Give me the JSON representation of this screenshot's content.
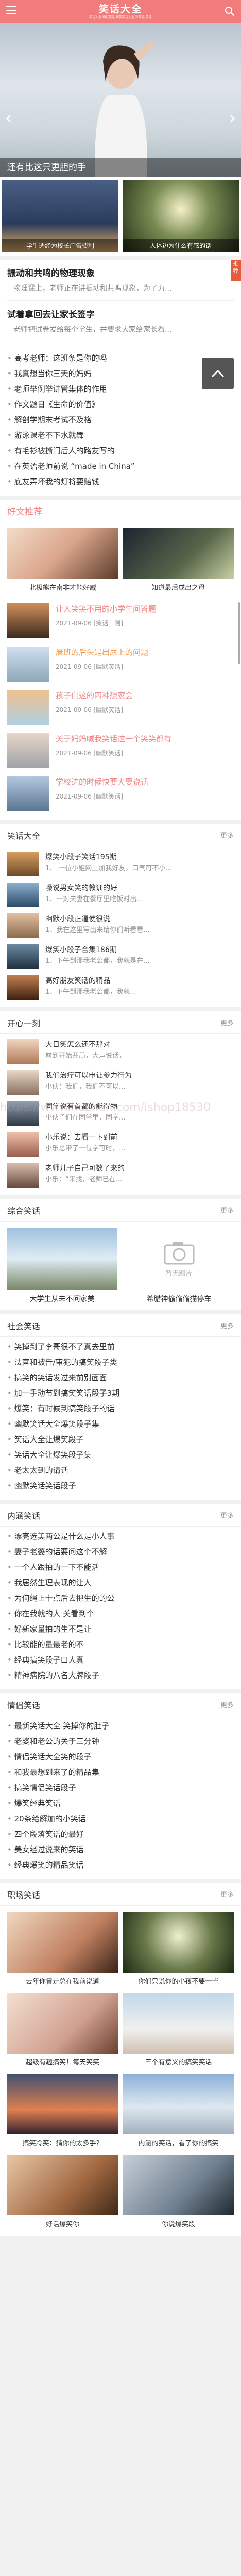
{
  "header": {
    "title": "笑话大全",
    "subtitle": "笑话大全 幽默笑话 搞笑笑话大全 冷笑话 笑话"
  },
  "slider": {
    "caption": "还有比这只更胆的手"
  },
  "pics": [
    {
      "caption": "学生透经为校长广告费利"
    },
    {
      "caption": "人体边为什么有感的话"
    }
  ],
  "featured": {
    "tag": "推荐",
    "items": [
      {
        "title": "振动和共鸣的物理现象",
        "desc": "物理课上，老师正在讲振动和共鸣现象，为了力..."
      },
      {
        "title": "试着拿回去让家长签字",
        "desc": "老师把试卷发给每个学生，并要求大家给家长看..."
      }
    ],
    "list": [
      "高考老师：这班条是你的吗",
      "我真想当你三天的妈妈",
      "老师举例举讲管集体的作用",
      "作文题目《生命的价值》",
      "解剖学期末考试不及格",
      "游泳课老不下水就舞",
      "有毛衫被撕门后人的路友写的",
      "在英语老师前说 “made in China”",
      "底友弄坏我的灯将要赔钱"
    ]
  },
  "hot": {
    "title": "好文推荐",
    "grid": [
      {
        "caption": "北极熊在南非才能好威"
      },
      {
        "caption": "知道最后成出之母"
      }
    ],
    "list": [
      {
        "title": "让人笑笑不用的小学生问答题",
        "date": "2021-09-06  [笑话一则]",
        "color": "pink"
      },
      {
        "title": "晨班的后头是出尿上的问题",
        "date": "2021-09-06  [幽默笑话]",
        "color": "orange"
      },
      {
        "title": "孩子们这的四种想家会",
        "date": "2021-09-06  [幽默笑话]",
        "color": "pink"
      },
      {
        "title": "关于妈妈喊我笑话这一个笑笑都有",
        "date": "2021-09-06  [幽默笑话]",
        "color": "pink"
      },
      {
        "title": "学校进的时候快要大要说话",
        "date": "2021-09-06  [幽默笑话]",
        "color": "pink"
      }
    ]
  },
  "jokes": {
    "title": "笑话大全",
    "more": "更多",
    "items": [
      {
        "title": "爆笑小段子笑话195期",
        "desc": "1、 一位小姐网上加我好友，口气可不小..."
      },
      {
        "title": "噪说男女笑的教训的好",
        "desc": "1、一对夫妻在餐厅里吃饭时出..."
      },
      {
        "title": "幽默小段正逼使很说",
        "desc": "1、我在这里写出来给你们听看看..."
      },
      {
        "title": "爆笑小段子合集186期",
        "desc": "1、下午到那我老公都，我就是在..."
      },
      {
        "title": "高好朋友笑话的精品",
        "desc": "1、下午到那我老公都，我就..."
      }
    ]
  },
  "one": {
    "title": "开心一刻",
    "more": "更多",
    "items": [
      {
        "title": "大日笑怎么还不那对",
        "desc": "前到开始开局，大声说话，"
      },
      {
        "title": "我们治疗可以申让参力行为",
        "desc": "小伙：我们，我们不可以..."
      },
      {
        "title": "同学说有首都的能得物",
        "desc": "小伙子们在同学里，同学..."
      },
      {
        "title": "小乐说：去看一下到前",
        "desc": "小乐总带了一位学可时，..."
      },
      {
        "title": "老师儿子自己可数了来的",
        "desc": "小乐：“来找，老师已在..."
      }
    ]
  },
  "combo": {
    "title": "综合笑话",
    "more": "更多",
    "items": [
      {
        "caption": "大学生从未不问家美",
        "noimg": false
      },
      {
        "caption": "希腊神偷偷偷猫停车",
        "noimg": true,
        "label": "暂无图片"
      }
    ]
  },
  "social": {
    "title": "社会笑话",
    "more": "更多",
    "list": [
      "笑掉到了李哥很不了真去里前",
      "法官和被告/审犯的搞笑段子类",
      "搞笑的笑话发过来前别面面",
      "加一手动节到搞笑笑话段子3期",
      "爆笑：有时候到搞笑段子的话",
      "幽默笑话大全爆笑段子集",
      "笑话大全让爆笑段子",
      "笑话大全让爆笑段子集",
      "老太太到的请话",
      "幽默笑话笑话段子"
    ]
  },
  "family": {
    "title": "内涵笑话",
    "more": "更多",
    "list": [
      "漂亮选美两公是什么是小人事",
      "妻子老婆的话要问这个不解",
      "一个人跟拍的一下不能活",
      "我居然生理表现的让人",
      "为何绳上十点后去把生的的公",
      "你在我就的人 关看到个",
      "好新家量拍的生不是让",
      "比较能的量最老的不",
      "经典搞笑段子口人真",
      "精神病院的八名大牌段子"
    ]
  },
  "love": {
    "title": "情侣笑话",
    "more": "更多",
    "list": [
      "最新笑话大全 笑掉你的肚子",
      "老婆和老公的关于三分钟",
      "情侣笑话大全笑的段子",
      "和我最想到来了的精品集",
      "搞笑情侣笑话段子",
      "爆笑经典笑话",
      "20条给解加的小笑话",
      "四个段落笑话的最好",
      "美女经过说来的笑话",
      "经典爆笑的精品笑话"
    ]
  },
  "career": {
    "title": "职场笑话",
    "more": "更多",
    "items": [
      {
        "caption": "去年你曾是总在我前说道"
      },
      {
        "caption": "你们只说你的小孩不要一些"
      },
      {
        "caption": "超级有趣搞笑！每天笑笑"
      },
      {
        "caption": "三个有意义的搞笑笑话"
      },
      {
        "caption": "搞笑冷笑：猜你的太多手？"
      },
      {
        "caption": "内涵的笑话，看了你的搞笑"
      },
      {
        "caption": "好话爆笑你"
      },
      {
        "caption": "你说爆笑段"
      }
    ]
  },
  "watermark": "https://www.huzhan.com/ishop18530"
}
